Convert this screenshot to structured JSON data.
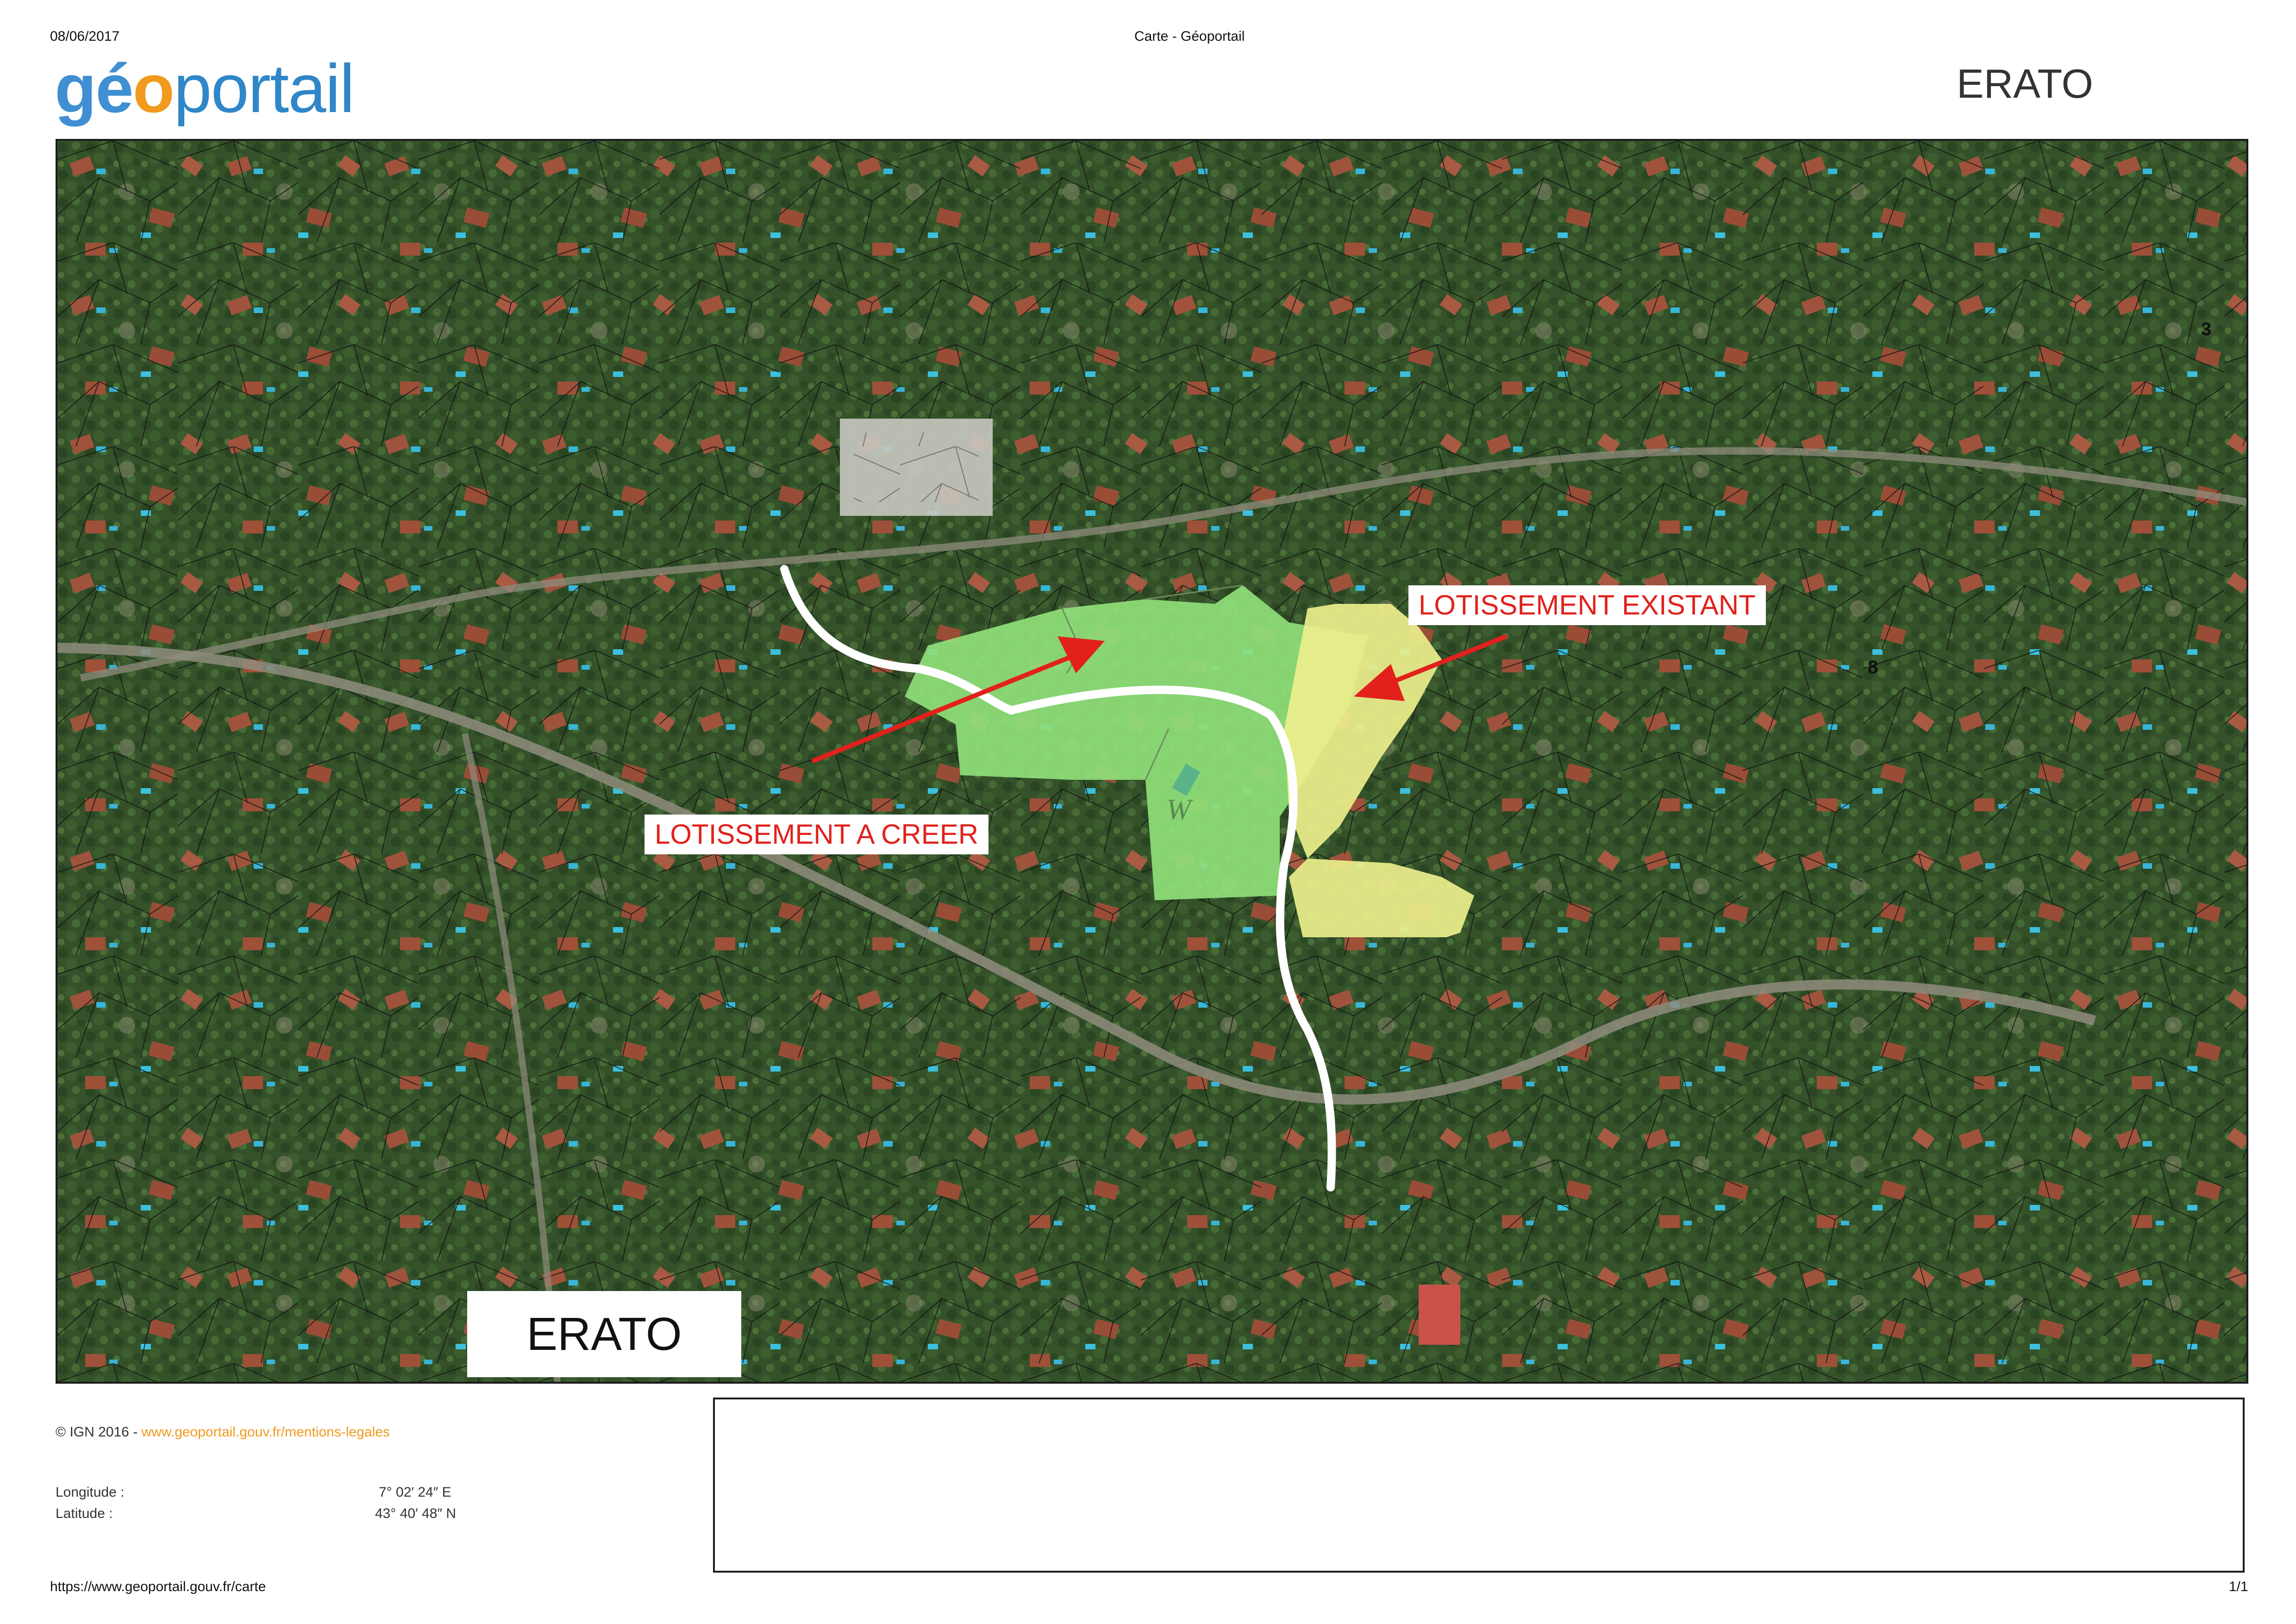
{
  "header": {
    "date": "08/06/2017",
    "page_title": "Carte - Géoportail",
    "logo": {
      "part1": "gé",
      "part2": "o",
      "part3": "portail"
    },
    "map_title": "ERATO"
  },
  "map": {
    "label_existing": "LOTISSEMENT EXISTANT",
    "label_new": "LOTISSEMENT A CREER",
    "label_erato": "ERATO",
    "parcel_letter": "W",
    "parcel_numbers": [
      "3",
      "8"
    ],
    "colors": {
      "new_zone": "#8fe07a",
      "existing_zone": "#ecef8c",
      "arrow": "#e2211c",
      "road": "#ffffff",
      "vegetation": "#34512a"
    }
  },
  "footer": {
    "copyright": "© IGN 2016 - ",
    "legal_link": "www.geoportail.gouv.fr/mentions-legales",
    "longitude_label": "Longitude :",
    "longitude_value": "7° 02′ 24″ E",
    "latitude_label": "Latitude :",
    "latitude_value": "43° 40′ 48″ N",
    "url": "https://www.geoportail.gouv.fr/carte",
    "page_count": "1/1"
  }
}
